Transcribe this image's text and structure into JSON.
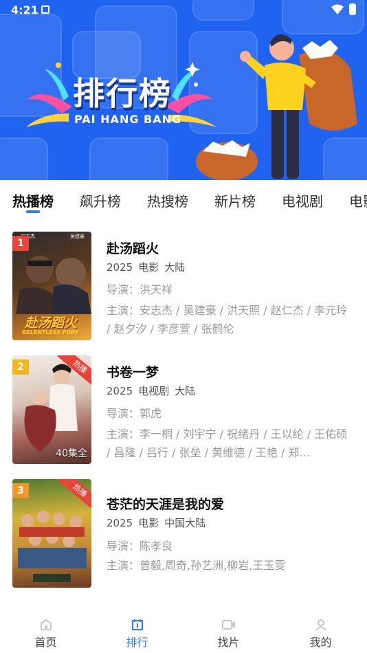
{
  "status_bar": {
    "time": "4:21"
  },
  "banner": {
    "title": "排行榜",
    "subtitle": "PAI HANG BANG"
  },
  "tabs": [
    {
      "label": "热播榜",
      "active": true
    },
    {
      "label": "飙升榜",
      "active": false
    },
    {
      "label": "热搜榜",
      "active": false
    },
    {
      "label": "新片榜",
      "active": false
    },
    {
      "label": "电视剧",
      "active": false
    },
    {
      "label": "电影",
      "active": false
    }
  ],
  "list": [
    {
      "rank": "1",
      "title": "赴汤蹈火",
      "year": "2025",
      "type": "电影",
      "region": "大陆",
      "director": "导演：洪天祥",
      "cast": "主演：安志杰 / 吴建豪 / 洪天照 / 赵仁杰 / 李元玲 / 赵夕汐 / 李彦萱 / 张鹤伦",
      "badge": "",
      "rank_color": "#e9443a",
      "poster_colors": [
        "#3a2a1c",
        "#8a5a2a",
        "#d08a2c"
      ],
      "poster_text": "赴汤蹈火",
      "poster_subtext": "RELENTLESS FURY",
      "poster_corner": "安志杰",
      "poster_corner2": "吴建豪",
      "poster_extra": ""
    },
    {
      "rank": "2",
      "title": "书卷一梦",
      "year": "2025",
      "type": "电视剧",
      "region": "大陆",
      "director": "导演：郭虎",
      "cast": "主演：李一桐 / 刘宇宁 / 祝绪丹 / 王以纶 / 王佑硕 / 昌隆 / 吕行 / 张垒 / 黄维德 / 王艳 / 郑…",
      "badge": "热播",
      "rank_color": "#f2b51d",
      "poster_colors": [
        "#e8e2da",
        "#b9968a",
        "#7a4a40"
      ],
      "poster_text": "",
      "poster_subtext": "",
      "poster_corner": "",
      "poster_corner2": "",
      "poster_extra": "40集全"
    },
    {
      "rank": "3",
      "title": "苍茫的天涯是我的爱",
      "year": "2025",
      "type": "电影",
      "region": "中国大陆",
      "director": "导演：陈孝良",
      "cast": "主演：曾毅,周奇,孙艺洲,柳岩,王玉雯",
      "badge": "热播",
      "rank_color": "#f0962e",
      "poster_colors": [
        "#3c6a2a",
        "#c9a23a",
        "#7a3a22"
      ],
      "poster_text": "",
      "poster_subtext": "",
      "poster_corner": "",
      "poster_corner2": "",
      "poster_extra": ""
    }
  ],
  "bottom_nav": [
    {
      "label": "首页",
      "icon": "home-icon",
      "active": false
    },
    {
      "label": "排行",
      "icon": "ranking-icon",
      "active": true
    },
    {
      "label": "找片",
      "icon": "video-camera-icon",
      "active": false
    },
    {
      "label": "我的",
      "icon": "user-icon",
      "active": false
    }
  ],
  "colors": {
    "accent": "#2f7bf5",
    "banner": "#1f63f0",
    "hot": "#e9443a"
  }
}
